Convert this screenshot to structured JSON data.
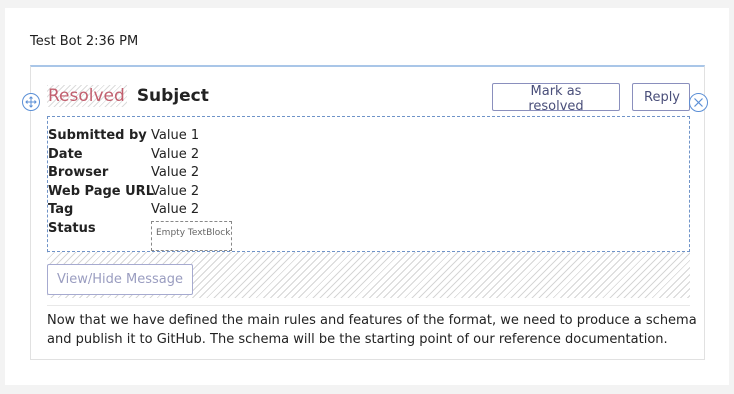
{
  "header": {
    "sender": "Test Bot",
    "time": "2:36 PM"
  },
  "card": {
    "status_label": "Resolved",
    "subject": "Subject",
    "actions": {
      "mark_resolved": "Mark as resolved",
      "reply": "Reply"
    },
    "facts": [
      {
        "key": "Submitted by",
        "value": "Value 1"
      },
      {
        "key": "Date",
        "value": "Value 2"
      },
      {
        "key": "Browser",
        "value": "Value 2"
      },
      {
        "key": "Web Page URL",
        "value": "Value 2"
      },
      {
        "key": "Tag",
        "value": "Value 2"
      },
      {
        "key": "Status",
        "value": ""
      }
    ],
    "empty_textblock": "Empty TextBlock",
    "view_hide": "View/Hide Message",
    "message": "Now that we have defined the main rules and features of the format, we need to produce a schema and publish it to GitHub. The schema will be the starting point of our reference documentation."
  },
  "colors": {
    "resolved_text": "#c25f6e",
    "button_border": "#8a8fbd",
    "selection_outline": "#6f93c8",
    "card_accent": "#a9c6e8"
  },
  "icons": {
    "move_handle": "move-arrows-icon",
    "close_handle": "close-circle-icon"
  }
}
